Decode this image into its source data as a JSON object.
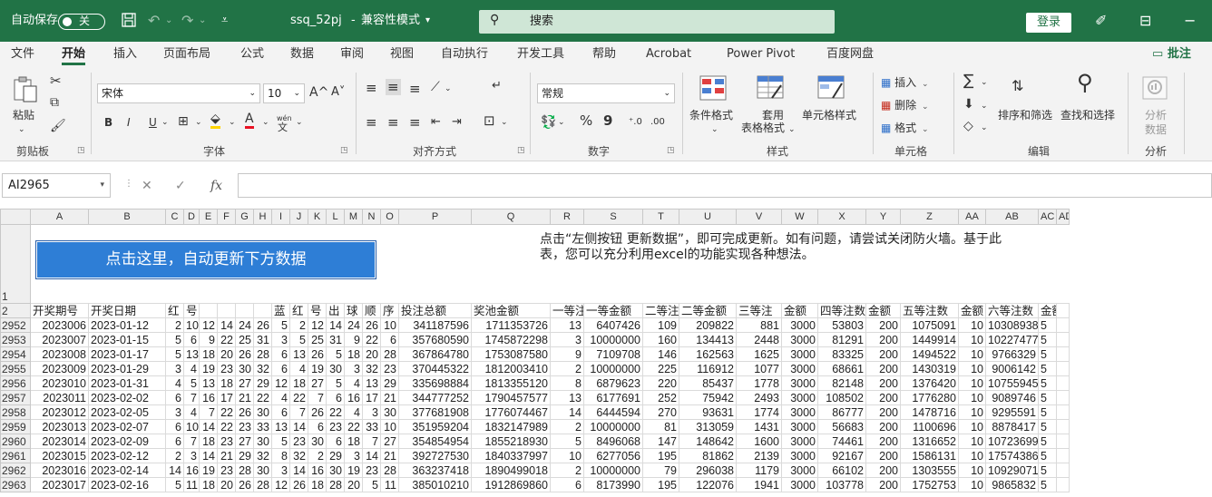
{
  "titlebar": {
    "autosave_label": "自动保存",
    "autosave_state": "关",
    "filename": "ssq_52pj",
    "separator": "-",
    "mode": "兼容性模式",
    "search_placeholder": "搜索",
    "login": "登录"
  },
  "tabs": [
    "文件",
    "开始",
    "插入",
    "页面布局",
    "公式",
    "数据",
    "审阅",
    "视图",
    "自动执行",
    "开发工具",
    "帮助",
    "Acrobat",
    "Power Pivot",
    "百度网盘"
  ],
  "active_tab": "开始",
  "comments_label": "批注",
  "ribbon": {
    "clipboard": {
      "paste": "粘贴",
      "group": "剪贴板"
    },
    "font": {
      "name": "宋体",
      "size": "10",
      "bold": "B",
      "italic": "I",
      "underline": "U",
      "grow": "A^",
      "shrink": "A˅",
      "font_color": "A",
      "wen": "wén",
      "group": "字体"
    },
    "alignment": {
      "group": "对齐方式"
    },
    "number": {
      "format": "常规",
      "percent": "%",
      "comma": "9",
      "group": "数字"
    },
    "styles": {
      "conditional": "条件格式",
      "table_line1": "套用",
      "table_line2": "表格格式",
      "cell_styles": "单元格样式",
      "group": "样式"
    },
    "cells": {
      "insert": "插入",
      "delete": "删除",
      "format": "格式",
      "group": "单元格"
    },
    "editing": {
      "sort": "排序和筛选",
      "find": "查找和选择",
      "sigma": "∑",
      "group": "编辑"
    },
    "analysis": {
      "analyze_line1": "分析",
      "analyze_line2": "数据",
      "group": "分析"
    }
  },
  "formula_bar": {
    "name_box": "AI2965",
    "fx": "fx",
    "value": ""
  },
  "sheet": {
    "columns": [
      "A",
      "B",
      "C",
      "D",
      "E",
      "F",
      "G",
      "H",
      "I",
      "J",
      "K",
      "L",
      "M",
      "N",
      "O",
      "P",
      "Q",
      "R",
      "S",
      "T",
      "U",
      "V",
      "W",
      "X",
      "Y",
      "Z",
      "AA",
      "AB",
      "AC",
      "AD"
    ],
    "update_button": "点击这里，自动更新下方数据",
    "note": "点击“左侧按钮 更新数据”，即可完成更新。如有问题，请尝试关闭防火墙。基于此表，您可以充分利用excel的功能实现各种想法。",
    "row1_number": "1",
    "row2_number": "2",
    "header_row": [
      "开奖期号",
      "开奖日期",
      "红",
      "号",
      "",
      "",
      "",
      "",
      "蓝",
      "红",
      "号",
      "出",
      "球",
      "顺",
      "序",
      "投注总额",
      "奖池金额",
      "一等注",
      "一等金额",
      "二等注",
      "二等金额",
      "三等注",
      "金额",
      "四等注数",
      "金额",
      "五等注数",
      "金额",
      "六等注数",
      "金额",
      ""
    ],
    "rows": [
      [
        "2952",
        "2023006",
        "2023-01-12",
        "2",
        "10",
        "12",
        "14",
        "24",
        "26",
        "5",
        "2",
        "12",
        "14",
        "24",
        "26",
        "10",
        "341187596",
        "1711353726",
        "13",
        "6407426",
        "109",
        "209822",
        "881",
        "3000",
        "53803",
        "200",
        "1075091",
        "10",
        "10308938",
        "5"
      ],
      [
        "2953",
        "2023007",
        "2023-01-15",
        "5",
        "6",
        "9",
        "22",
        "25",
        "31",
        "3",
        "5",
        "25",
        "31",
        "9",
        "22",
        "6",
        "357680590",
        "1745872298",
        "3",
        "10000000",
        "160",
        "134413",
        "2448",
        "3000",
        "81291",
        "200",
        "1449914",
        "10",
        "10227477",
        "5"
      ],
      [
        "2954",
        "2023008",
        "2023-01-17",
        "5",
        "13",
        "18",
        "20",
        "26",
        "28",
        "6",
        "13",
        "26",
        "5",
        "18",
        "20",
        "28",
        "367864780",
        "1753087580",
        "9",
        "7109708",
        "146",
        "162563",
        "1625",
        "3000",
        "83325",
        "200",
        "1494522",
        "10",
        "9766329",
        "5"
      ],
      [
        "2955",
        "2023009",
        "2023-01-29",
        "3",
        "4",
        "19",
        "23",
        "30",
        "32",
        "6",
        "4",
        "19",
        "30",
        "3",
        "32",
        "23",
        "370445322",
        "1812003410",
        "2",
        "10000000",
        "225",
        "116912",
        "1077",
        "3000",
        "68661",
        "200",
        "1430319",
        "10",
        "9006142",
        "5"
      ],
      [
        "2956",
        "2023010",
        "2023-01-31",
        "4",
        "5",
        "13",
        "18",
        "27",
        "29",
        "12",
        "18",
        "27",
        "5",
        "4",
        "13",
        "29",
        "335698884",
        "1813355120",
        "8",
        "6879623",
        "220",
        "85437",
        "1778",
        "3000",
        "82148",
        "200",
        "1376420",
        "10",
        "10755945",
        "5"
      ],
      [
        "2957",
        "2023011",
        "2023-02-02",
        "6",
        "7",
        "16",
        "17",
        "21",
        "22",
        "4",
        "22",
        "7",
        "6",
        "16",
        "17",
        "21",
        "344777252",
        "1790457577",
        "13",
        "6177691",
        "252",
        "75942",
        "2493",
        "3000",
        "108502",
        "200",
        "1776280",
        "10",
        "9089746",
        "5"
      ],
      [
        "2958",
        "2023012",
        "2023-02-05",
        "3",
        "4",
        "7",
        "22",
        "26",
        "30",
        "6",
        "7",
        "26",
        "22",
        "4",
        "3",
        "30",
        "377681908",
        "1776074467",
        "14",
        "6444594",
        "270",
        "93631",
        "1774",
        "3000",
        "86777",
        "200",
        "1478716",
        "10",
        "9295591",
        "5"
      ],
      [
        "2959",
        "2023013",
        "2023-02-07",
        "6",
        "10",
        "14",
        "22",
        "23",
        "33",
        "13",
        "14",
        "6",
        "23",
        "22",
        "33",
        "10",
        "351959204",
        "1832147989",
        "2",
        "10000000",
        "81",
        "313059",
        "1431",
        "3000",
        "56683",
        "200",
        "1100696",
        "10",
        "8878417",
        "5"
      ],
      [
        "2960",
        "2023014",
        "2023-02-09",
        "6",
        "7",
        "18",
        "23",
        "27",
        "30",
        "5",
        "23",
        "30",
        "6",
        "18",
        "7",
        "27",
        "354854954",
        "1855218930",
        "5",
        "8496068",
        "147",
        "148642",
        "1600",
        "3000",
        "74461",
        "200",
        "1316652",
        "10",
        "10723699",
        "5"
      ],
      [
        "2961",
        "2023015",
        "2023-02-12",
        "2",
        "3",
        "14",
        "21",
        "29",
        "32",
        "8",
        "32",
        "2",
        "29",
        "3",
        "14",
        "21",
        "392727530",
        "1840337997",
        "10",
        "6277056",
        "195",
        "81862",
        "2139",
        "3000",
        "92167",
        "200",
        "1586131",
        "10",
        "17574386",
        "5"
      ],
      [
        "2962",
        "2023016",
        "2023-02-14",
        "14",
        "16",
        "19",
        "23",
        "28",
        "30",
        "3",
        "14",
        "16",
        "30",
        "19",
        "23",
        "28",
        "363237418",
        "1890499018",
        "2",
        "10000000",
        "79",
        "296038",
        "1179",
        "3000",
        "66102",
        "200",
        "1303555",
        "10",
        "10929071",
        "5"
      ],
      [
        "2963",
        "2023017",
        "2023-02-16",
        "5",
        "11",
        "18",
        "20",
        "26",
        "28",
        "12",
        "26",
        "18",
        "28",
        "20",
        "5",
        "11",
        "385010210",
        "1912869860",
        "6",
        "8173990",
        "195",
        "122076",
        "1941",
        "3000",
        "103778",
        "200",
        "1752753",
        "10",
        "9865832",
        "5"
      ]
    ]
  }
}
